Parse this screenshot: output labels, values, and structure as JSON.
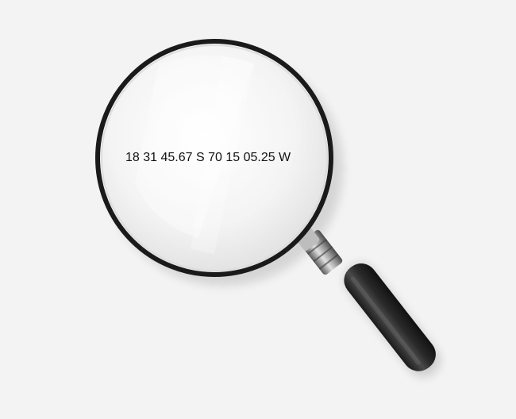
{
  "lens_text": "18 31 45.67 S 70 15 05.25 W",
  "icon": "magnifying-glass-icon",
  "colors": {
    "background": "#f3f3f3",
    "rim": "#1a1a1a",
    "handle": "#2b2b2b",
    "ferrule": "#9a9a9a",
    "text": "#111111"
  }
}
